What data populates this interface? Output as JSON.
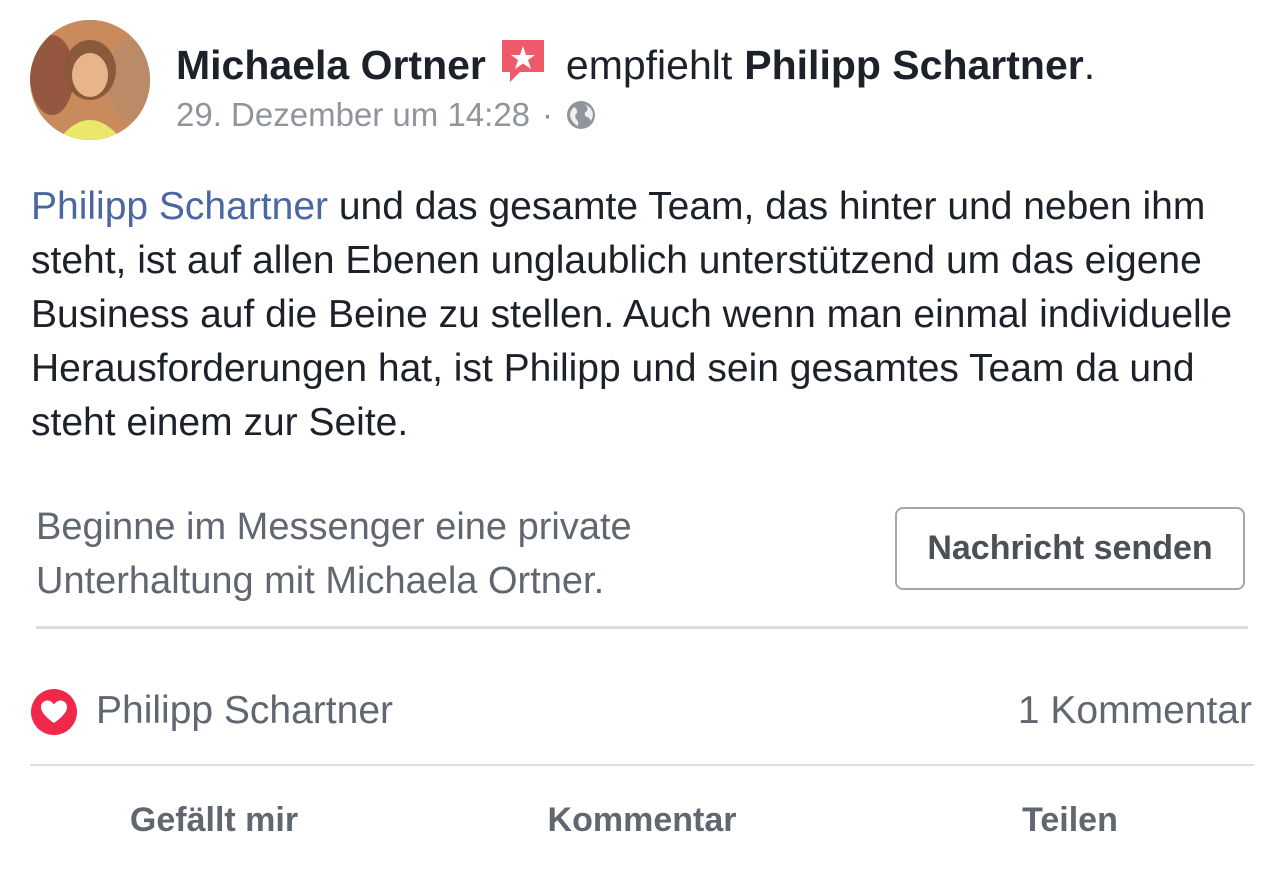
{
  "post": {
    "author": "Michaela Ortner",
    "recommend_icon": "recommendation-star-icon",
    "action": "empfiehlt",
    "page": "Philipp Schartner",
    "period": ".",
    "timestamp": "29. Dezember um 14:28",
    "meta_separator": "·",
    "privacy_icon": "globe-icon",
    "mention": "Philipp Schartner",
    "text": " und das gesamte Team, das hinter und neben ihm steht, ist auf allen Ebenen unglaublich unterstützend um das eigene Business auf die Beine zu stellen. Auch wenn man einmal individuelle Herausforderungen hat, ist Philipp und sein gesamtes Team da und steht einem zur Seite."
  },
  "messenger": {
    "prompt": "Beginne im Messenger eine private Unterhaltung mit Michaela Ortner.",
    "button_label": "Nachricht senden"
  },
  "reactions": {
    "icon": "heart-icon",
    "reactor": "Philipp Schartner",
    "comments": "1 Kommentar"
  },
  "actions": {
    "like": "Gefällt mir",
    "comment": "Kommentar",
    "share": "Teilen"
  },
  "colors": {
    "link_blue": "#4b67a1",
    "heart_red": "#f0284a",
    "muted_text": "#606770",
    "timestamp_gray": "#90949c"
  }
}
